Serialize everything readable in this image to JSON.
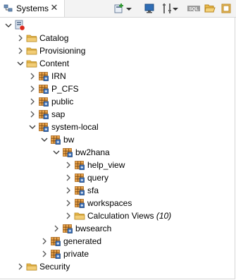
{
  "tab": {
    "label": "Systems",
    "close": "✕"
  },
  "toolbar": {
    "icons": [
      "add-system-icon",
      "dropdown-arrow-icon",
      "monitor-icon",
      "tools-icon",
      "sql-icon",
      "open-folder-icon",
      "object-icon"
    ],
    "sql_label": "SQL"
  },
  "tree": {
    "items": [
      {
        "label": "",
        "icon": "system-icon",
        "expanded": true
      },
      {
        "label": "Catalog",
        "icon": "folder-icon",
        "expanded": false
      },
      {
        "label": "Provisioning",
        "icon": "folder-icon",
        "expanded": false
      },
      {
        "label": "Content",
        "icon": "folder-icon",
        "expanded": true
      },
      {
        "label": "IRN",
        "icon": "package-icon",
        "expanded": false
      },
      {
        "label": "P_CFS",
        "icon": "package-icon",
        "expanded": false
      },
      {
        "label": "public",
        "icon": "package-icon",
        "expanded": false
      },
      {
        "label": "sap",
        "icon": "package-icon",
        "expanded": false
      },
      {
        "label": "system-local",
        "icon": "package-icon",
        "expanded": true
      },
      {
        "label": "bw",
        "icon": "package-icon",
        "expanded": true
      },
      {
        "label": "bw2hana",
        "icon": "package-icon",
        "expanded": true
      },
      {
        "label": "help_view",
        "icon": "package-icon",
        "expanded": false
      },
      {
        "label": "query",
        "icon": "package-icon",
        "expanded": false
      },
      {
        "label": "sfa",
        "icon": "package-icon",
        "expanded": false
      },
      {
        "label": "workspaces",
        "icon": "package-icon",
        "expanded": false
      },
      {
        "label": "Calculation Views",
        "count": "(10)",
        "icon": "folder-icon",
        "expanded": false
      },
      {
        "label": "bwsearch",
        "icon": "package-icon",
        "expanded": false
      },
      {
        "label": "generated",
        "icon": "package-icon",
        "expanded": false
      },
      {
        "label": "private",
        "icon": "package-icon",
        "expanded": false
      },
      {
        "label": "Security",
        "icon": "folder-icon",
        "expanded": false
      }
    ]
  },
  "colors": {
    "folder": "#e8b84a",
    "package_orange": "#d98c2b",
    "package_blue": "#3b6fb6",
    "system_red": "#d9261c"
  }
}
